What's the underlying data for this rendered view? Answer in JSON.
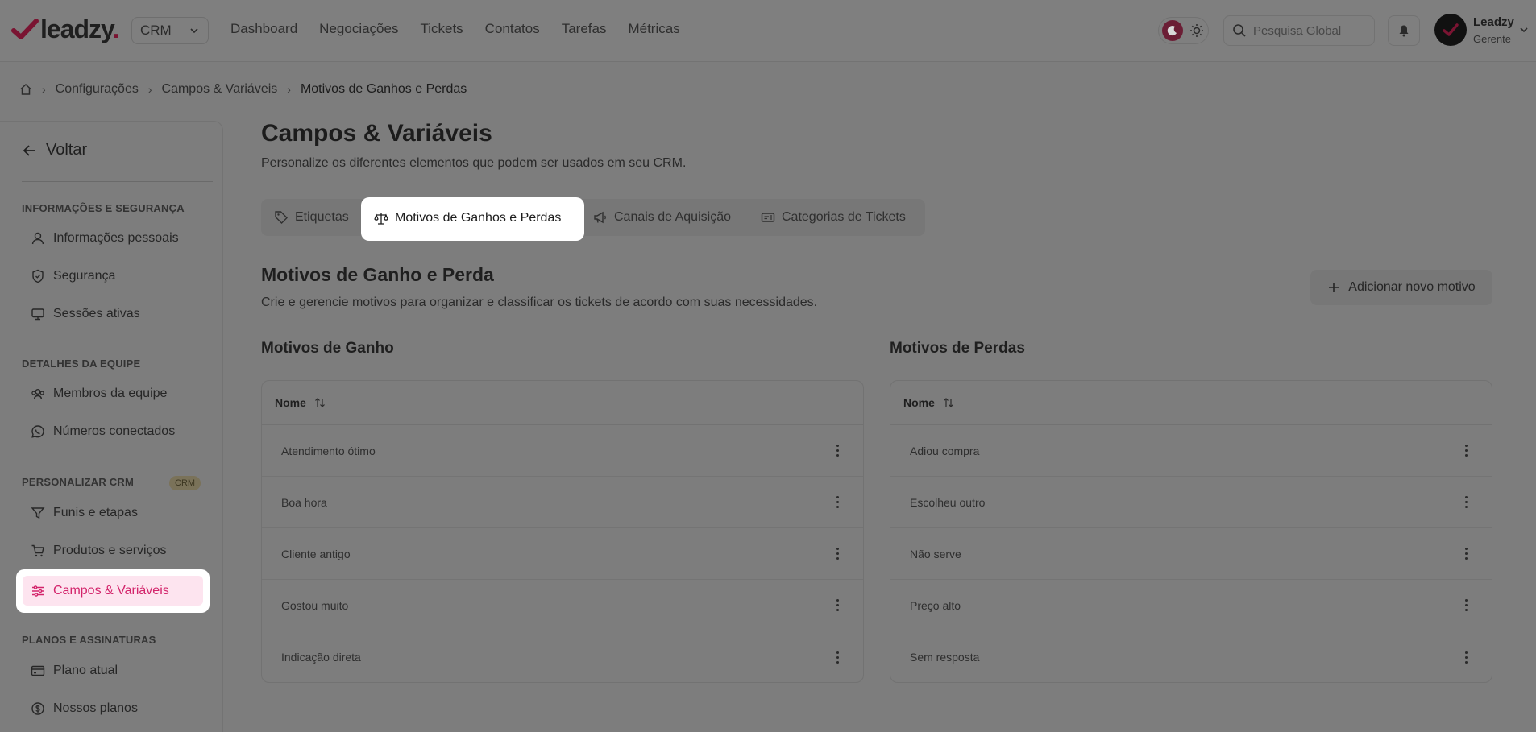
{
  "header": {
    "logo_text": "leadzy",
    "logo_dot": ".",
    "product_select": "CRM",
    "nav": [
      "Dashboard",
      "Negociações",
      "Tickets",
      "Contatos",
      "Tarefas",
      "Métricas"
    ],
    "search_placeholder": "Pesquisa Global",
    "user_name": "Leadzy",
    "user_role": "Gerente"
  },
  "breadcrumb": [
    "Configurações",
    "Campos & Variáveis",
    "Motivos de Ganhos e Perdas"
  ],
  "sidebar": {
    "back_label": "Voltar",
    "sections": [
      {
        "title": "INFORMAÇÕES E SEGURANÇA",
        "items": [
          "Informações pessoais",
          "Segurança",
          "Sessões ativas"
        ]
      },
      {
        "title": "DETALHES DA EQUIPE",
        "items": [
          "Membros da equipe",
          "Números conectados"
        ]
      },
      {
        "title": "PERSONALIZAR CRM",
        "badge": "CRM",
        "items": [
          "Funis e etapas",
          "Produtos e serviços",
          "Campos & Variáveis"
        ]
      },
      {
        "title": "PLANOS E ASSINATURAS",
        "items": [
          "Plano atual",
          "Nossos planos"
        ]
      }
    ],
    "active_item": "Campos & Variáveis"
  },
  "main": {
    "title": "Campos & Variáveis",
    "subtitle": "Personalize os diferentes elementos que podem ser usados em seu CRM.",
    "tabs": [
      "Etiquetas",
      "Motivos de Ganhos e Perdas",
      "Canais de Aquisição",
      "Categorias de Tickets"
    ],
    "active_tab": "Motivos de Ganhos e Perdas",
    "section_title": "Motivos de Ganho e Perda",
    "section_subtitle": "Crie e gerencie motivos para organizar e classificar os tickets de acordo com suas necessidades.",
    "add_button": "Adicionar novo motivo",
    "gains": {
      "title": "Motivos de Ganho",
      "column": "Nome",
      "rows": [
        "Atendimento ótimo",
        "Boa hora",
        "Cliente antigo",
        "Gostou muito",
        "Indicação direta"
      ]
    },
    "losses": {
      "title": "Motivos de Perdas",
      "column": "Nome",
      "rows": [
        "Adiou compra",
        "Escolheu outro",
        "Não serve",
        "Preço alto",
        "Sem resposta"
      ]
    }
  },
  "colors": {
    "accent": "#d3246b",
    "active_bg": "#fde4ef",
    "overlay": "#7d7d7d"
  }
}
